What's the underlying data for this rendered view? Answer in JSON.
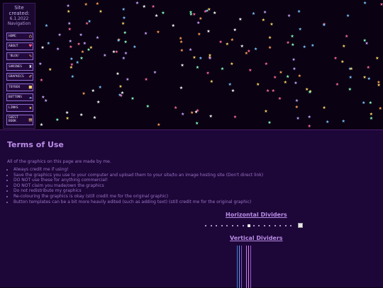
{
  "site_info": {
    "label": "Site",
    "created_label": "created:",
    "created_date": "6.1.2022",
    "nav_label": "Navigation"
  },
  "nav": {
    "items": [
      {
        "label": "HOME",
        "icon": "house-icon"
      },
      {
        "label": "ABOUT",
        "icon": "bow-icon"
      },
      {
        "label": "'BLOG'",
        "icon": "pencil-icon"
      },
      {
        "label": "SHRINES",
        "icon": "candle-icon"
      },
      {
        "label": "GRAPHICS",
        "icon": "paint-icon"
      },
      {
        "label": "TOYBOX",
        "icon": "toybox-icon"
      },
      {
        "label": "BUTTONS",
        "icon": "cloud-icon"
      },
      {
        "label": "LINKS",
        "icon": "star-icon"
      },
      {
        "label_line1": "GUEST",
        "label_line2": "BOOK",
        "icon": "book-icon"
      }
    ]
  },
  "main": {
    "title": "Terms of Use",
    "intro": "All of the graphics on this page are made by me.",
    "rules": [
      "Always credit me if using!",
      "Save the graphics you use to your computer and upload them to your site/to an image hosting site (Don't direct link)",
      "DO NOT use these for anything commercial!",
      "DO NOT claim you made/own the graphics",
      "Do not redistribute my graphics",
      "Re-colouring the graphics is okay (still credit me for the original graphic)",
      "Button templates can be a bit more heavily edited (such as adding text) (still credit me for the original graphic)"
    ],
    "horizontal_dividers_title": "Horizontal Dividers",
    "vertical_dividers_title": "Vertical Dividers"
  },
  "colors": {
    "background": "#0a0212",
    "content_bg": "#1d0638",
    "heading": "#b98de6",
    "text": "#9a74c6",
    "nav_border": "#8f6ccf",
    "star_colors": [
      "#ff6b9d",
      "#ffd86b",
      "#7bc4ff",
      "#c9a3ff",
      "#ffffff",
      "#ff9f5a",
      "#8affc1"
    ]
  }
}
